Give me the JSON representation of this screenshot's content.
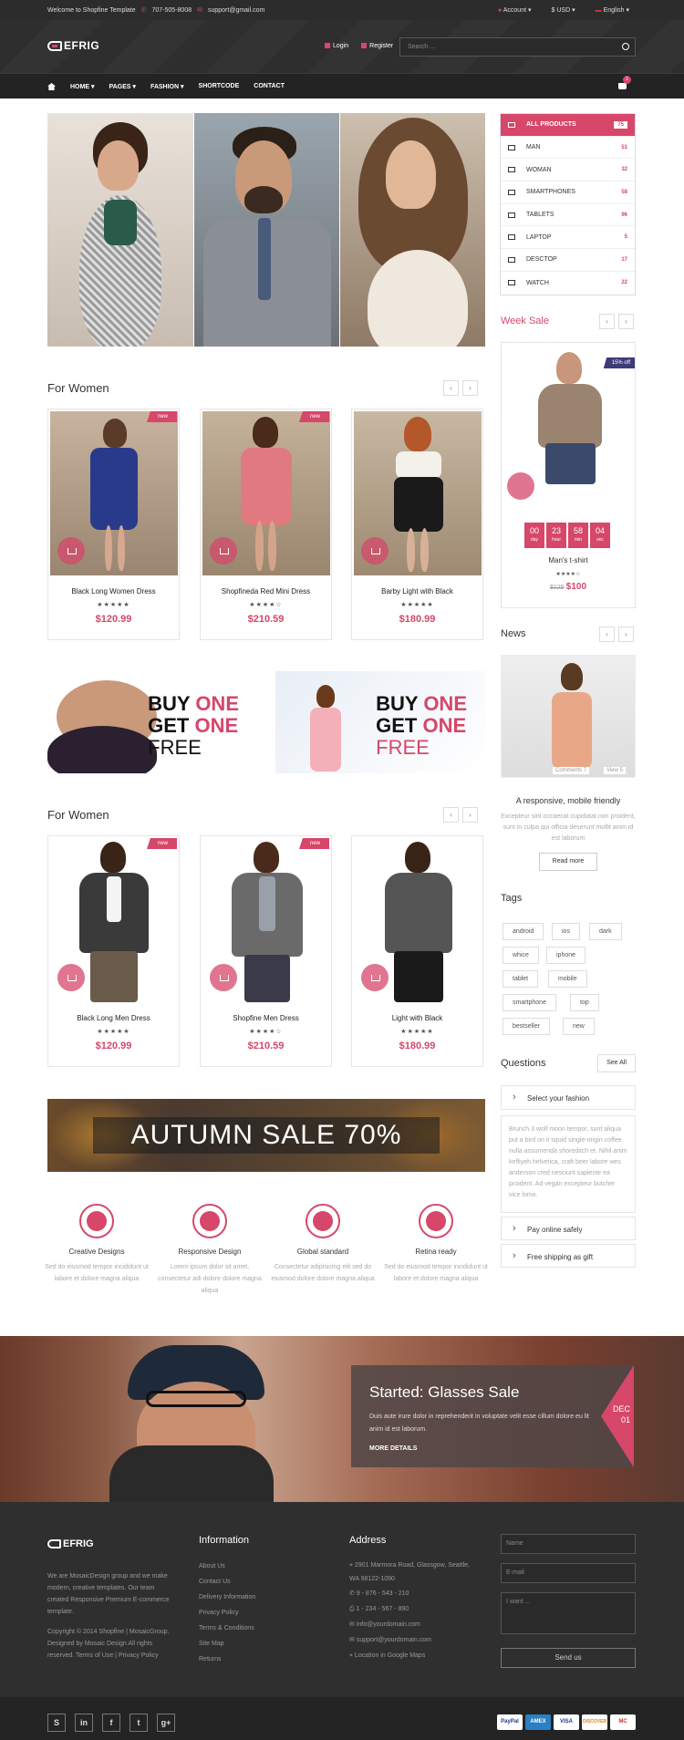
{
  "topbar": {
    "welcome": "Welcome to Shopfine Template",
    "phone": "707-505-8008",
    "email": "support@gmail.com",
    "account": "Account",
    "currency": "$ USD",
    "language": "English"
  },
  "brand": {
    "logo": "EFRIG"
  },
  "header": {
    "login": "Login",
    "register": "Register",
    "search_placeholder": "Search ..."
  },
  "nav": {
    "items": [
      "HOME",
      "PAGES",
      "FASHION",
      "SHORTCODE",
      "CONTACT"
    ],
    "cart_count": "1"
  },
  "categories": [
    {
      "label": "ALL PRODUCTS",
      "count": "75"
    },
    {
      "label": "MAN",
      "count": "51"
    },
    {
      "label": "WOMAN",
      "count": "32"
    },
    {
      "label": "SMARTPHONES",
      "count": "58"
    },
    {
      "label": "TABLETS",
      "count": "96"
    },
    {
      "label": "LAPTOP",
      "count": "5"
    },
    {
      "label": "DESCTOP",
      "count": "17"
    },
    {
      "label": "WATCH",
      "count": "22"
    }
  ],
  "section_women": {
    "title": "For Women",
    "products": [
      {
        "name": "Black Long Women Dress",
        "price": "$120.99",
        "badge": "new",
        "stars": "★★★★★"
      },
      {
        "name": "Shopfineda Red Mini Dress",
        "price": "$210.59",
        "badge": "new",
        "stars": "★★★★☆"
      },
      {
        "name": "Barby Light with Black",
        "price": "$180.99",
        "badge": "",
        "stars": "★★★★★"
      }
    ]
  },
  "section_men": {
    "title": "For Women",
    "products": [
      {
        "name": "Black Long Men Dress",
        "price": "$120.99",
        "badge": "new",
        "stars": "★★★★★"
      },
      {
        "name": "Shopfine Men Dress",
        "price": "$210.59",
        "badge": "new",
        "stars": "★★★★☆"
      },
      {
        "name": "Light with Black",
        "price": "$180.99",
        "badge": "",
        "stars": "★★★★★"
      }
    ]
  },
  "promo": {
    "buy": "BUY",
    "one": "ONE",
    "get": "GET",
    "free": "FREE"
  },
  "autumn": "AUTUMN SALE 70%",
  "features": [
    {
      "title": "Creative Designs",
      "desc": "Sed do eiusmod tempor incididunt ut labore et dolore magna aliqua"
    },
    {
      "title": "Responsive Design",
      "desc": "Lorem ipsum dolor sit amet, consectetur adi dolore dolore magna aliqua"
    },
    {
      "title": "Global standard",
      "desc": "Consectetur adipisicing elit sed do eiusmod dolore dolore magna aliqua"
    },
    {
      "title": "Retina ready",
      "desc": "Sed do eiusmod tempor incididunt ut labore et dolore magna aliqua"
    }
  ],
  "week_sale": {
    "title": "Week Sale",
    "off": "15% off",
    "timer": [
      {
        "v": "00",
        "u": "day"
      },
      {
        "v": "23",
        "u": "hour"
      },
      {
        "v": "58",
        "u": "min"
      },
      {
        "v": "04",
        "u": "sec"
      }
    ],
    "name": "Man's t-shirt",
    "old": "$125",
    "price": "$100",
    "stars": "★★★★☆"
  },
  "news": {
    "title": "News",
    "comments": "Comments 7",
    "views": "View 5",
    "heading": "A responsive, mobile friendly",
    "text": "Excepteur sint occaecat cupidatat non proident, sunt in culpa qui officia deserunt mollit anim id est laborum",
    "button": "Read more"
  },
  "tags": {
    "title": "Tags",
    "items": [
      "android",
      "ios",
      "dark",
      "whice",
      "iphone",
      "tablet",
      "mobile",
      "smartphone",
      "top",
      "bestseller",
      "new"
    ]
  },
  "questions": {
    "title": "Questions",
    "see_all": "See All",
    "q1": "Select your fashion",
    "text": "Brunch 3 wolf moon tempor, sunt aliqua put a bird on it squid single-origin coffee nulla assumenda shoreditch et. Nihil anim keffiyeh helvetica, craft beer labore wes anderson cred nesciunt sapiente ea proident. Ad vegan excepteur butcher vice lomo.",
    "q2": "Pay online safely",
    "q3": "Free shipping as gift"
  },
  "glasses": {
    "title": "Started: Glasses Sale",
    "text": "Duis aute irure dolor in reprehenderit in voluptate velit esse cillum dolore eu lit anim id est laborum.",
    "more": "MORE DETAILS",
    "month": "DEC",
    "day": "01"
  },
  "footer": {
    "about": "We are MosaicDesign group and we make modern, creative templates. Our team created Responsive Premium E-commerce template.",
    "copyright": "Copyright © 2014 Shopfine | MosaicGroup. Designed by Mosaic Design All rights reserved. Terms of Use | Privacy Policy",
    "info_title": "Information",
    "info": [
      "About Us",
      "Contact Us",
      "Delivery Information",
      "Privacy Policy",
      "Terms & Conditions",
      "Site Map",
      "Returns"
    ],
    "address_title": "Address",
    "address": [
      "2901 Marmora Road, Glassgow, Seattle, WA 98122-1090",
      "9 - 876 - 543 - 210",
      "1 - 234 - 567 - 890",
      "info@yourdomain.com",
      "support@yourdomain.com",
      "Location in Google Maps"
    ],
    "form": {
      "name": "Name",
      "email": "E-mail",
      "message": "I want ...",
      "send": "Send us"
    }
  },
  "social": [
    "S",
    "in",
    "f",
    "t",
    "g+"
  ],
  "payments": [
    {
      "label": "PayPal",
      "bg": "#ffffff",
      "fg": "#1a3a8a"
    },
    {
      "label": "AMEX",
      "bg": "#2b7fc2",
      "fg": "#ffffff"
    },
    {
      "label": "VISA",
      "bg": "#ffffff",
      "fg": "#1a3a8a"
    },
    {
      "label": "DISCOVER",
      "bg": "#ffffff",
      "fg": "#e67e22"
    },
    {
      "label": "MC",
      "bg": "#ffffff",
      "fg": "#c0392b"
    }
  ],
  "colors": {
    "accent": "#d6476a",
    "dark": "#2c2c2c"
  }
}
